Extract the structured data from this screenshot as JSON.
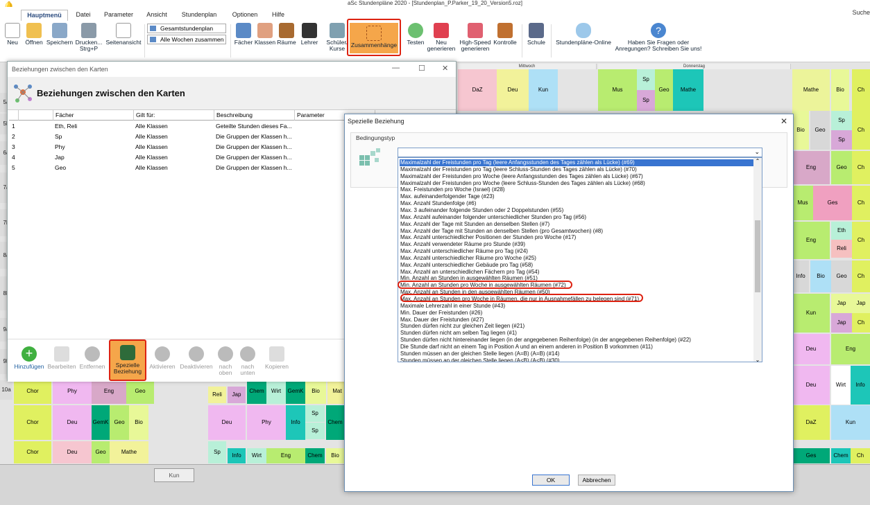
{
  "app_title": "aSc Stundenpläne 2020 - [Stundenplan_P.Parker_19_20_Version5.roz]",
  "menu": [
    "Hauptmenü",
    "Datei",
    "Parameter",
    "Ansicht",
    "Stundenplan",
    "Optionen",
    "Hilfe"
  ],
  "search": "Suche",
  "ribbon": {
    "neu": "Neu",
    "oeffnen": "Öffnen",
    "speichern": "Speichern",
    "drucken": "Drucken... Strg+P",
    "seitenansicht": "Seitenansicht",
    "combo1": "Gesamtstundenplan",
    "combo2": "Alle Wochen zusammen",
    "faecher": "Fächer",
    "klassen": "Klassen",
    "raeume": "Räume",
    "lehrer": "Lehrer",
    "schueler": "Schüler/ Kurse",
    "zusammenhaenge": "Zusammenhänge",
    "testen": "Testen",
    "neu_generieren": "Neu generieren",
    "highspeed": "High-Speed generieren",
    "kontrolle": "Kontrolle",
    "schule": "Schule",
    "online": "Stundenpläne-Online",
    "fragen": "Haben Sie Fragen oder Anregungen? Schreiben Sie uns!"
  },
  "grid": {
    "day_mi": "Mittwoch",
    "day_do": "Donnerstag",
    "rows": [
      "5a",
      "5b",
      "6a",
      "7a",
      "7b",
      "8a",
      "8b",
      "9a",
      "9b",
      "10a"
    ],
    "cells": [
      {
        "t": "DaZ",
        "c": "#f6c6d0"
      },
      {
        "t": "Deu",
        "c": "#f2f29a"
      },
      {
        "t": "Kun",
        "c": "#aee0f6"
      },
      {
        "t": "Mus",
        "c": "#b8ec70"
      },
      {
        "t": "Sp",
        "c": "#b8f0d8"
      },
      {
        "t": "Sp",
        "c": "#d8a8d8"
      },
      {
        "t": "Geo",
        "c": "#b8ec70"
      },
      {
        "t": "Mathe",
        "c": "#1dc6b8"
      },
      {
        "t": "Mathe",
        "c": "#ecf49a"
      },
      {
        "t": "Bio",
        "c": "#e8f898"
      },
      {
        "t": "Ch",
        "c": "#e0f060"
      },
      {
        "t": "Bio",
        "c": "#e8f898"
      },
      {
        "t": "Geo",
        "c": "#d8d8d8"
      },
      {
        "t": "Sp",
        "c": "#b8f0d8"
      },
      {
        "t": "Sp",
        "c": "#d8a8d8"
      },
      {
        "t": "Ch",
        "c": "#e0f060"
      },
      {
        "t": "Eng",
        "c": "#d8a8c8"
      },
      {
        "t": "Geo",
        "c": "#b8ec70"
      },
      {
        "t": "Ch",
        "c": "#e0f060"
      },
      {
        "t": "Mus",
        "c": "#b8ec70"
      },
      {
        "t": "Ges",
        "c": "#f0a0c0"
      },
      {
        "t": "Ch",
        "c": "#e0f060"
      },
      {
        "t": "Eng",
        "c": "#b8ec70"
      },
      {
        "t": "Eth",
        "c": "#b8f0d8"
      },
      {
        "t": "Reli",
        "c": "#f6c0c0"
      },
      {
        "t": "Ch",
        "c": "#e0f060"
      },
      {
        "t": "Info",
        "c": "#d8d8d8"
      },
      {
        "t": "Bio",
        "c": "#aee0f6"
      },
      {
        "t": "Geo",
        "c": "#d8d8d8"
      },
      {
        "t": "Ch",
        "c": "#e0f060"
      },
      {
        "t": "Kun",
        "c": "#b8ec70"
      },
      {
        "t": "Jap",
        "c": "#e8f898"
      },
      {
        "t": "Jap",
        "c": "#e8f898"
      },
      {
        "t": "Jap",
        "c": "#d8a8d8"
      },
      {
        "t": "Ch",
        "c": "#e0f060"
      },
      {
        "t": "Deu",
        "c": "#f0b8f0"
      },
      {
        "t": "Eng",
        "c": "#b8ec70"
      },
      {
        "t": "Chor",
        "c": "#e0f060"
      },
      {
        "t": "Phy",
        "c": "#f0b8f0"
      },
      {
        "t": "Eng",
        "c": "#d8a8c8"
      },
      {
        "t": "Geo",
        "c": "#b8ec70"
      },
      {
        "t": "Reli",
        "c": "#f2f29a"
      },
      {
        "t": "Jap",
        "c": "#d8a8d8"
      },
      {
        "t": "Chem",
        "c": "#00a878"
      },
      {
        "t": "Wirt",
        "c": "#b8f0d8"
      },
      {
        "t": "GemK",
        "c": "#00a878"
      },
      {
        "t": "Bio",
        "c": "#e8f898"
      },
      {
        "t": "Mat",
        "c": "#f2f29a"
      },
      {
        "t": "Deu",
        "c": "#f0b8f0"
      },
      {
        "t": "Wirt",
        "c": "#ffffff"
      },
      {
        "t": "Info",
        "c": "#1dc6b8"
      },
      {
        "t": "Chor",
        "c": "#e0f060"
      },
      {
        "t": "Deu",
        "c": "#f0b8f0"
      },
      {
        "t": "GemK",
        "c": "#00a878"
      },
      {
        "t": "Geo",
        "c": "#b8ec70"
      },
      {
        "t": "Bio",
        "c": "#e8f898"
      },
      {
        "t": "Deu",
        "c": "#f0b8f0"
      },
      {
        "t": "Phy",
        "c": "#f0b8f0"
      },
      {
        "t": "Info",
        "c": "#1dc6b8"
      },
      {
        "t": "Sp",
        "c": "#b8f0d8"
      },
      {
        "t": "Sp",
        "c": "#b8f0d8"
      },
      {
        "t": "Chem",
        "c": "#00a878"
      },
      {
        "t": "DaZ",
        "c": "#e0f060"
      },
      {
        "t": "Kun",
        "c": "#aee0f6"
      },
      {
        "t": "Chor",
        "c": "#e0f060"
      },
      {
        "t": "Deu",
        "c": "#f6c6d0"
      },
      {
        "t": "Geo",
        "c": "#b8ec70"
      },
      {
        "t": "Mathe",
        "c": "#f2f29a"
      },
      {
        "t": "Sp",
        "c": "#b8f0d8"
      },
      {
        "t": "Info",
        "c": "#1dc6b8"
      },
      {
        "t": "Wirt",
        "c": "#b8f0d8"
      },
      {
        "t": "Eng",
        "c": "#b8ec70"
      },
      {
        "t": "Chem",
        "c": "#00a878"
      },
      {
        "t": "Bio",
        "c": "#e8f898"
      },
      {
        "t": "Ges",
        "c": "#00a878"
      },
      {
        "t": "Chem",
        "c": "#1dc6b8"
      },
      {
        "t": "Ch",
        "c": "#e0f060"
      }
    ]
  },
  "kun_btn": "Kun",
  "win1": {
    "titlebar": "Beziehungen zwischen den Karten",
    "heading": "Beziehungen zwischen den Karten",
    "cols": [
      "Fächer",
      "Gilt für:",
      "Beschreibung",
      "Parameter"
    ],
    "rows": [
      {
        "n": "1",
        "f": "Eth, Reli",
        "g": "Alle Klassen",
        "b": "Geteilte Stunden dieses Fa..."
      },
      {
        "n": "2",
        "f": "Sp",
        "g": "Alle Klassen",
        "b": "Die Gruppen der Klassen h..."
      },
      {
        "n": "3",
        "f": "Phy",
        "g": "Alle Klassen",
        "b": "Die Gruppen der Klassen h..."
      },
      {
        "n": "4",
        "f": "Jap",
        "g": "Alle Klassen",
        "b": "Die Gruppen der Klassen h..."
      },
      {
        "n": "5",
        "f": "Geo",
        "g": "Alle Klassen",
        "b": "Die Gruppen der Klassen h..."
      }
    ],
    "tools": {
      "hinzu": "Hinzufügen",
      "bearb": "Bearbeiten",
      "entf": "Entfernen",
      "spez": "Spezielle Beziehung",
      "akt": "Aktivieren",
      "deakt": "Deaktivieren",
      "oben": "nach oben",
      "unten": "nach unten",
      "kop": "Kopieren"
    }
  },
  "win2": {
    "titlebar": "Spezielle Beziehung",
    "group_label": "Bedingungstyp",
    "items": [
      "Maximalzahl der Freistunden pro Tag (leere Anfangsstunden des Tages zählen als Lücke) (#69)",
      "Maximalzahl der Freistunden pro Tag (leere Schluss-Stunden des Tages zählen als Lücke) (#70)",
      "Maximalzahl der Freistunden pro Woche (leere Anfangsstunden des Tages zählen als Lücke) (#67)",
      "Maximalzahl der Freistunden pro Woche (leere Schluss-Stunden des Tages zählen als Lücke) (#68)",
      "Max. Freistunden pro Woche (Israel) (#28)",
      "Max. aufeinanderfolgender Tage (#23)",
      "Max. Anzahl Stundenfolge (#6)",
      "Max. 3 aufeinander folgende Stunden oder 2 Doppelstunden (#55)",
      "Max. Anzahl aufeinander folgender unterschiedlicher Stunden pro Tag (#56)",
      "Max. Anzahl der Tage mit Stunden an denselben Stellen (#7)",
      "Max. Anzahl der Tage mit Stunden an denselben Stellen (pro Gesamtwochen) (#8)",
      "Max. Anzahl unterschiedlicher Positionen der Stunden pro Woche (#17)",
      "Max. Anzahl verwendeter Räume pro Stunde (#39)",
      "Max. Anzahl unterschiedlicher Räume pro Tag (#24)",
      "Max. Anzahl unterschiedlicher Räume pro Woche (#25)",
      "Max. Anzahl unterschiedlicher Gebäude pro Tag (#58)",
      "Max. Anzahl an unterschiedlichen Fächern pro Tag (#54)",
      "Min. Anzahl an Stunden in ausgewählten Räumen (#51)",
      "Min. Anzahl an Stunden pro Woche in ausgewählten Räumen (#72)",
      "Max. Anzahl an Stunden in den ausgewählten Räumen (#50)",
      "Max. Anzahl an Stunden pro Woche in Räumen, die nur in Ausnahmefällen zu belegen sind (#71)",
      "Maximale Lehrerzahl in einer Stunde (#43)",
      "Min. Dauer der Freistunden (#26)",
      "Max. Dauer der Freistunden (#27)",
      "Stunden dürfen nicht zur gleichen Zeit liegen (#21)",
      "Stunden dürfen nicht am selben Tag liegen (#1)",
      "Stunden dürfen nicht hintereinander liegen (in der angegebenen Reihenfolge) (in der angegebenen Reihenfolge) (#22)",
      "Die Stunde darf nicht an einem Tag in Position A und an einem anderen in Position B vorkommen (#11)",
      "Stunden müssen an der gleichen Stelle liegen (A=B) (A=B) (#14)",
      "Stunden müssen an der gleichen Stelle liegen (A<B) (A<B) (#30)"
    ],
    "ok": "OK",
    "cancel": "Abbrechen"
  }
}
